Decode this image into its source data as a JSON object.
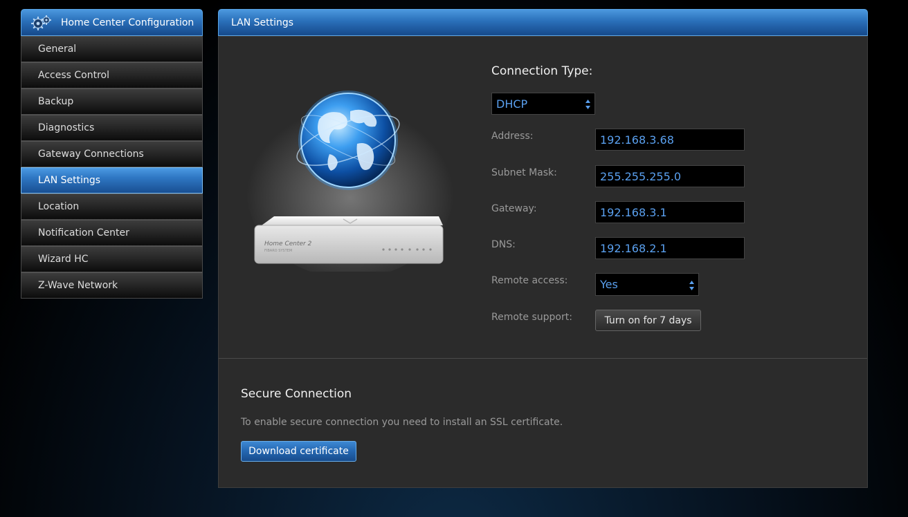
{
  "sidebar": {
    "title": "Home Center Configuration",
    "items": [
      {
        "label": "General"
      },
      {
        "label": "Access Control"
      },
      {
        "label": "Backup"
      },
      {
        "label": "Diagnostics"
      },
      {
        "label": "Gateway Connections"
      },
      {
        "label": "LAN Settings"
      },
      {
        "label": "Location"
      },
      {
        "label": "Notification Center"
      },
      {
        "label": "Wizard HC"
      },
      {
        "label": "Z-Wave Network"
      }
    ],
    "active_index": 5
  },
  "panel": {
    "title": "LAN Settings",
    "connection_type_label": "Connection Type:",
    "connection_type_value": "DHCP",
    "fields": {
      "address": {
        "label": "Address:",
        "value": "192.168.3.68"
      },
      "subnet": {
        "label": "Subnet Mask:",
        "value": "255.255.255.0"
      },
      "gateway": {
        "label": "Gateway:",
        "value": "192.168.3.1"
      },
      "dns": {
        "label": "DNS:",
        "value": "192.168.2.1"
      }
    },
    "remote_access": {
      "label": "Remote access:",
      "value": "Yes"
    },
    "remote_support": {
      "label": "Remote support:",
      "button": "Turn on for 7 days"
    },
    "device_label": "Home Center 2",
    "device_sublabel": "FIBARO SYSTEM"
  },
  "secure": {
    "title": "Secure Connection",
    "text": "To enable secure connection you need to install an SSL certificate.",
    "button": "Download certificate"
  },
  "colors": {
    "accent_blue": "#2a6fb9",
    "value_blue": "#5aa0ef",
    "panel_bg": "#2b2b2b"
  },
  "icons": {
    "header": "gears-icon",
    "select": "up-down-arrows-icon",
    "hero": "globe-router-illustration"
  }
}
